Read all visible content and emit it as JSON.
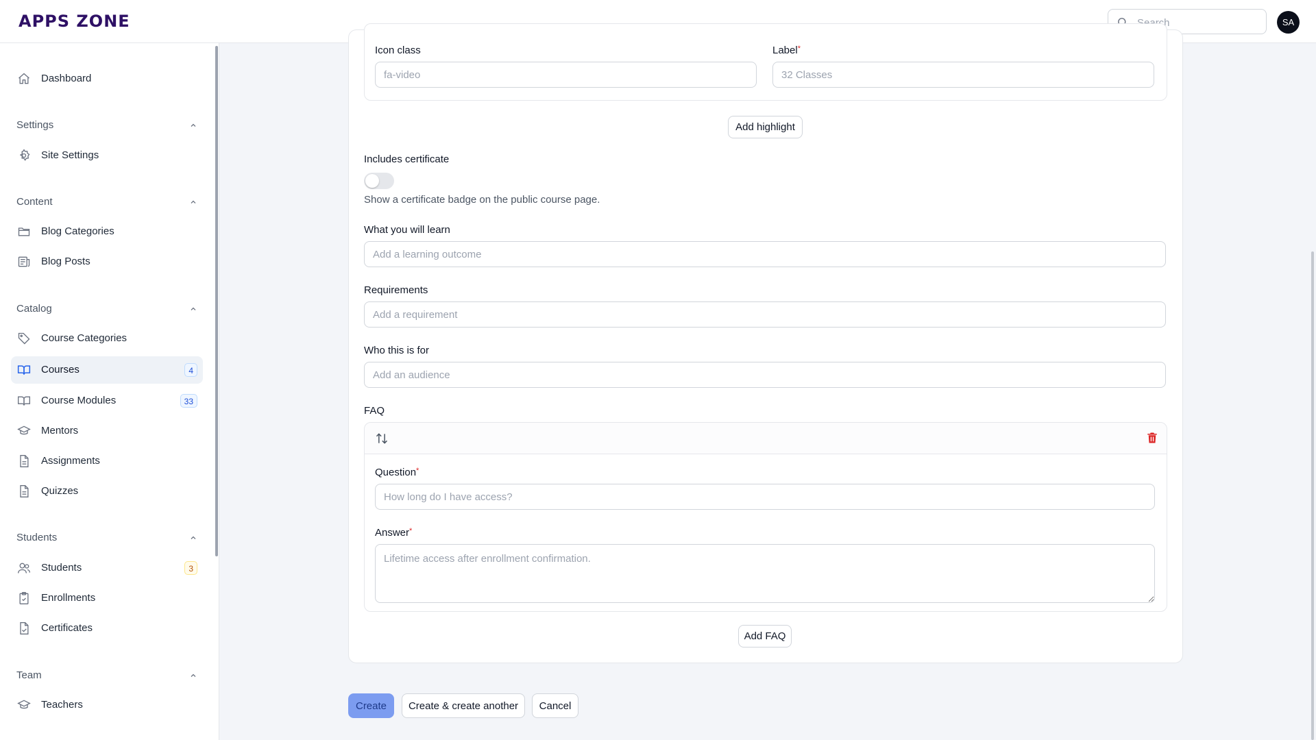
{
  "app": {
    "logo": "APPS ZONE"
  },
  "header": {
    "search_placeholder": "Search",
    "avatar_initials": "SA"
  },
  "sidebar": {
    "dashboard": "Dashboard",
    "groups": {
      "settings": "Settings",
      "content": "Content",
      "catalog": "Catalog",
      "students": "Students",
      "team": "Team"
    },
    "items": {
      "site_settings": "Site Settings",
      "blog_categories": "Blog Categories",
      "blog_posts": "Blog Posts",
      "course_categories": "Course Categories",
      "courses": "Courses",
      "courses_badge": "4",
      "course_modules": "Course Modules",
      "course_modules_badge": "33",
      "mentors": "Mentors",
      "assignments": "Assignments",
      "quizzes": "Quizzes",
      "students": "Students",
      "students_badge": "3",
      "enrollments": "Enrollments",
      "certificates": "Certificates",
      "teachers": "Teachers"
    }
  },
  "form": {
    "highlight": {
      "icon_class_label": "Icon class",
      "icon_class_placeholder": "fa-video",
      "label_label": "Label",
      "label_placeholder": "32 Classes",
      "add_button": "Add highlight"
    },
    "certificate": {
      "label": "Includes certificate",
      "enabled": false,
      "helper": "Show a certificate badge on the public course page."
    },
    "learn": {
      "label": "What you will learn",
      "placeholder": "Add a learning outcome"
    },
    "requirements": {
      "label": "Requirements",
      "placeholder": "Add a requirement"
    },
    "audience": {
      "label": "Who this is for",
      "placeholder": "Add an audience"
    },
    "faq": {
      "label": "FAQ",
      "question_label": "Question",
      "question_placeholder": "How long do I have access?",
      "answer_label": "Answer",
      "answer_placeholder": "Lifetime access after enrollment confirmation.",
      "add_button": "Add FAQ"
    },
    "required_mark": "*"
  },
  "actions": {
    "create": "Create",
    "create_another": "Create & create another",
    "cancel": "Cancel"
  },
  "colors": {
    "primary": "#7c9cf0",
    "danger": "#dc2626",
    "logo": "#2e1065"
  }
}
